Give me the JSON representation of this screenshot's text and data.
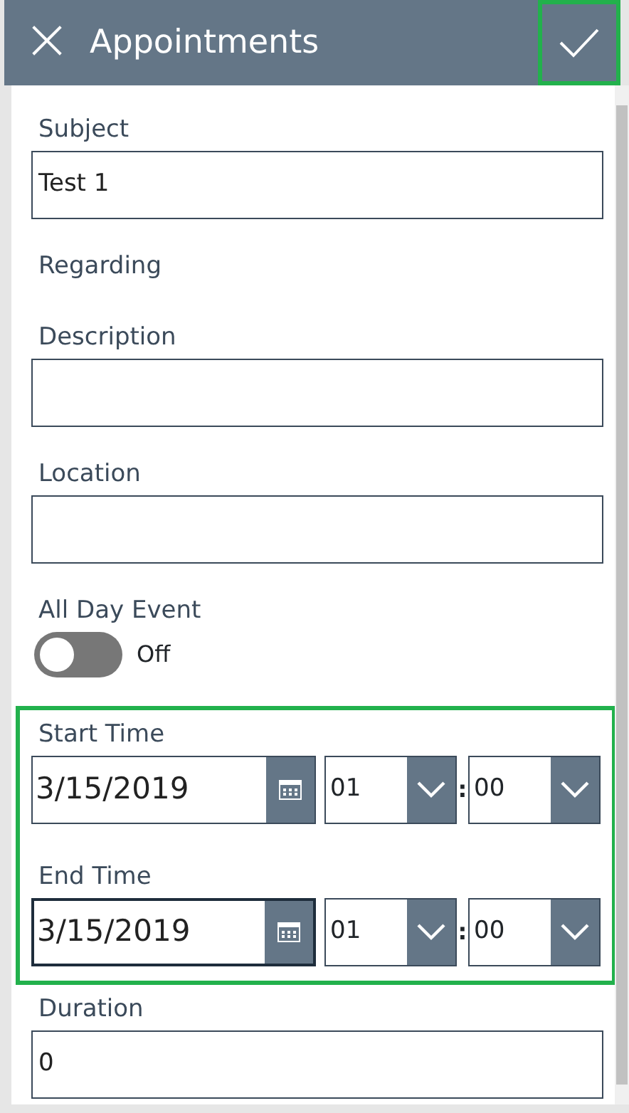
{
  "header": {
    "title": "Appointments",
    "close_icon": "×",
    "save": {
      "highlighted": true
    }
  },
  "fields": [
    {
      "kind": "text",
      "label": "Subject",
      "value": "Test 1"
    },
    {
      "kind": "lookup",
      "label": "Regarding"
    },
    {
      "kind": "text",
      "label": "Description"
    },
    {
      "kind": "text",
      "label": "Location"
    },
    {
      "kind": "toggle",
      "label": "All Day Event",
      "on": false,
      "state_text": "Off"
    }
  ],
  "time_section": {
    "highlighted": true,
    "items": [
      {
        "label": "Start Time",
        "date": "3/15/2019",
        "hour": "01",
        "separator": ":",
        "minute": "00",
        "focused": false
      },
      {
        "label": "End Time",
        "date": "3/15/2019",
        "hour": "01",
        "separator": ":",
        "minute": "00",
        "focused": true
      }
    ]
  },
  "duration": {
    "label": "Duration",
    "value": "0"
  }
}
